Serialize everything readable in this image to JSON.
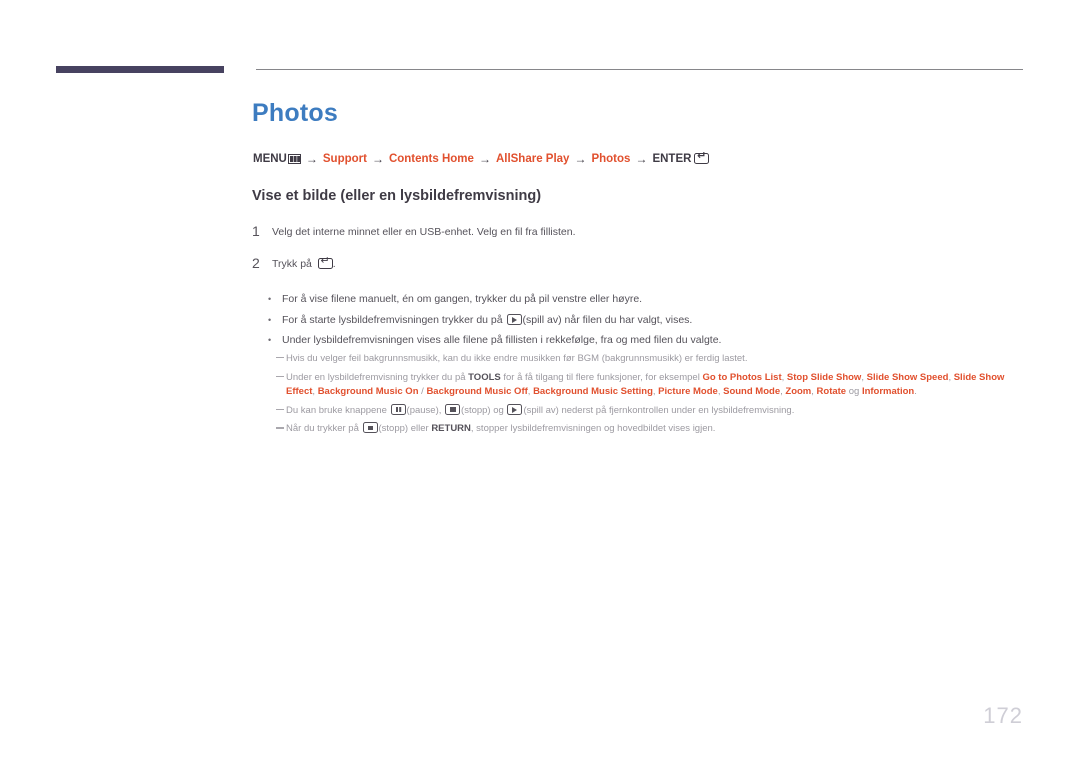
{
  "header": {
    "bar_color": "#474260",
    "rule_color": "#86868a"
  },
  "page_title": "Photos",
  "title_color": "#3d7cc0",
  "breadcrumb": {
    "name": "menu-path",
    "segments": [
      {
        "label": "MENU",
        "type": "plain",
        "icon": "menu-icon"
      },
      {
        "label": "Support",
        "type": "link"
      },
      {
        "label": "Contents Home",
        "type": "link"
      },
      {
        "label": "AllShare Play",
        "type": "link"
      },
      {
        "label": "Photos",
        "type": "link"
      },
      {
        "label": "ENTER",
        "type": "plain",
        "icon": "enter-icon"
      }
    ],
    "arrow": "→",
    "link_color": "#e1502e"
  },
  "section_heading": "Vise et bilde (eller en lysbildefremvisning)",
  "steps": [
    {
      "number": "1",
      "text": "Velg det interne minnet eller en USB-enhet. Velg en fil fra fillisten."
    },
    {
      "number": "2",
      "text_before": "Trykk på ",
      "icon": "enter-icon",
      "text_after": "."
    }
  ],
  "bullets": [
    {
      "marker": "•",
      "text": "For å vise filene manuelt, én om gangen, trykker du på pil venstre eller høyre."
    },
    {
      "marker": "•",
      "text_before": "For å starte lysbildefremvisningen trykker du på ",
      "icon": "play-icon",
      "text_after": "(spill av) når filen du har valgt, vises."
    },
    {
      "marker": "•",
      "text": "Under lysbildefremvisningen vises alle filene på fillisten i rekkefølge, fra og med filen du valgte."
    }
  ],
  "notes": [
    {
      "id": "note-bgm-load",
      "text": "Hvis du velger feil bakgrunnsmusikk, kan du ikke endre musikken før BGM (bakgrunnsmusikk) er ferdig lastet."
    },
    {
      "id": "note-tools",
      "lead": "Under en lysbildefremvisning trykker du på ",
      "tools_label": "TOOLS",
      "mid": " for å få tilgang til flere funksjoner, for eksempel ",
      "options": [
        "Go to Photos List",
        "Stop Slide Show",
        "Slide Show Speed",
        "Slide Show Effect",
        "Background Music On",
        "Background Music Off",
        "Background Music Setting",
        "Picture Mode",
        "Sound Mode",
        "Zoom",
        "Rotate",
        "Information"
      ],
      "separator": ", ",
      "slash": " / ",
      "conjunction": " og ",
      "end": "."
    },
    {
      "id": "note-remote-buttons",
      "lead": "Du kan bruke knappene ",
      "pause_label": "(pause), ",
      "stop_label": "(stopp) og ",
      "play_label": "(spill av) nederst på fjernkontrollen under en lysbildefremvisning."
    },
    {
      "id": "note-return",
      "lead": "Når du trykker på ",
      "stop_label": "(stopp) eller ",
      "return_label": "RETURN",
      "tail": ", stopper lysbildefremvisningen og hovedbildet vises igjen."
    }
  ],
  "page_number": "172"
}
